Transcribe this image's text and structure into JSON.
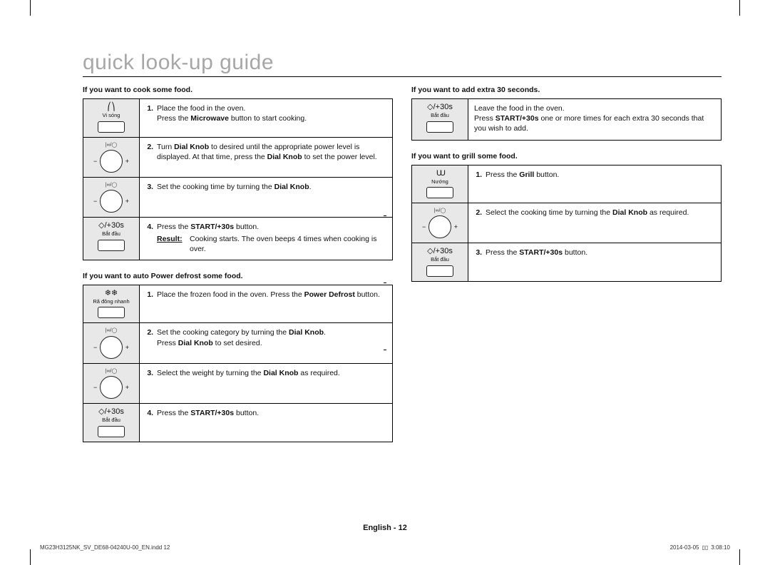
{
  "title": "quick look-up guide",
  "sections": {
    "cook": {
      "heading": "If you want to cook some food.",
      "icons": {
        "microwave_sym": "⎛⎞",
        "microwave_cap": "Vi sóng",
        "dial_cap": "|∞/◯",
        "start_sym": "◇/+30s",
        "start_cap": "Bắt đầu"
      },
      "steps": {
        "s1a": "Place the food in the oven.",
        "s1b_pre": "Press the ",
        "s1b_bold": "Microwave",
        "s1b_post": " button to start cooking.",
        "s2_pre": "Turn ",
        "s2_bold1": "Dial Knob",
        "s2_mid": " to desired until the appropriate power level is displayed. At that time, press the ",
        "s2_bold2": "Dial Knob",
        "s2_post": " to set the power level.",
        "s3_pre": "Set the cooking time by turning the ",
        "s3_bold": "Dial Knob",
        "s3_post": ".",
        "s4_pre": "Press the ",
        "s4_bold": "START/+30s",
        "s4_post": " button.",
        "result_label": "Result:",
        "result_text": "Cooking starts. The oven beeps 4 times when cooking is over."
      }
    },
    "defrost": {
      "heading": "If you want to auto Power defrost some food.",
      "icons": {
        "defrost_sym": "❄❄",
        "defrost_cap": "Rã đông nhanh",
        "dial_cap": "|∞/◯",
        "start_sym": "◇/+30s",
        "start_cap": "Bắt đầu"
      },
      "steps": {
        "s1_pre": "Place the frozen food in the oven. Press the ",
        "s1_bold": "Power Defrost",
        "s1_post": " button.",
        "s2_pre": "Set the cooking category by turning the ",
        "s2_bold": "Dial Knob",
        "s2_post": ".",
        "s2b_pre": "Press ",
        "s2b_bold": "Dial Knob",
        "s2b_post": " to set desired.",
        "s3_pre": "Select the weight by turning the ",
        "s3_bold": "Dial Knob",
        "s3_post": " as required.",
        "s4_pre": "Press the ",
        "s4_bold": "START/+30s",
        "s4_post": " button."
      }
    },
    "extra30": {
      "heading": "If you want to add extra 30 seconds.",
      "icons": {
        "start_sym": "◇/+30s",
        "start_cap": "Bắt đầu"
      },
      "text": {
        "l1": "Leave the food in the oven.",
        "l2_pre": "Press ",
        "l2_bold": "START/+30s",
        "l2_post": " one or more times for each extra 30 seconds that you wish to add."
      }
    },
    "grill": {
      "heading": "If you want to grill some food.",
      "icons": {
        "grill_sym": "UU",
        "grill_cap": "Nướng",
        "dial_cap": "|∞/◯",
        "start_sym": "◇/+30s",
        "start_cap": "Bắt đầu"
      },
      "steps": {
        "s1_pre": "Press the ",
        "s1_bold": "Grill",
        "s1_post": " button.",
        "s2_pre": "Select the cooking time by turning the ",
        "s2_bold": "Dial Knob",
        "s2_post": " as required.",
        "s3_pre": "Press the ",
        "s3_bold": "START/+30s",
        "s3_post": " button."
      }
    }
  },
  "footer": {
    "center": "English - 12",
    "left": "MG23H3125NK_SV_DE68-04240U-00_EN.indd   12",
    "right_date": "2014-03-05",
    "right_time": "3:08:10",
    "right_sep": "▯▯"
  }
}
